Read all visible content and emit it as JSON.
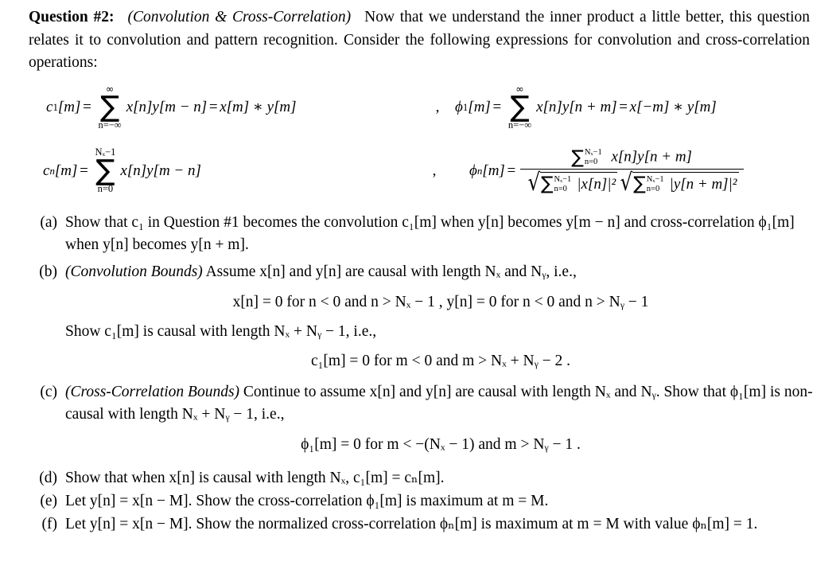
{
  "header": {
    "question_label": "Question #2:",
    "topic": "(Convolution & Cross-Correlation)",
    "paragraph": "Now that we understand the inner product a little better, this question relates it to convolution and pattern recognition. Consider the following expressions for convolution and cross-correlation operations:"
  },
  "equations": {
    "row1": {
      "c1": {
        "lhs_var": "c",
        "lhs_sub": "1",
        "lhs_arg": "[m]",
        "equals": "=",
        "sum_top": "∞",
        "sum_bottom": "n=−∞",
        "summand": "x[n]y[m − n]",
        "equals2": "=",
        "rhs": "x[m] ∗ y[m]"
      },
      "separator": ",",
      "phi1": {
        "lhs_var": "ϕ",
        "lhs_sub": "1",
        "lhs_arg": "[m]",
        "equals": "=",
        "sum_top": "∞",
        "sum_bottom": "n=−∞",
        "summand": "x[n]y[n + m]",
        "equals2": "=",
        "rhs": "x[−m] ∗ y[m]"
      }
    },
    "row2": {
      "cn": {
        "lhs_var": "c",
        "lhs_sub": "n",
        "lhs_arg": "[m]",
        "equals": "=",
        "sum_top": "Nₓ−1",
        "sum_bottom": "n=0",
        "summand": "x[n]y[m − n]"
      },
      "separator": ",",
      "phin": {
        "lhs_var": "ϕ",
        "lhs_sub": "n",
        "lhs_arg": "[m]",
        "equals": "=",
        "numerator_sum_top": "Nₓ−1",
        "numerator_sum_bottom": "n=0",
        "numerator_summand": "x[n]y[n + m]",
        "denom_left_sum_top": "Nₓ−1",
        "denom_left_sum_bottom": "n=0",
        "denom_left_summand": "|x[n]|²",
        "denom_right_sum_top": "Nₓ−1",
        "denom_right_sum_bottom": "n=0",
        "denom_right_summand": "|y[n + m]|²"
      }
    }
  },
  "parts": [
    {
      "marker": "(a)",
      "text_line1": "Show that c₁ in Question #1 becomes the convolution c₁[m] when y[n] becomes y[m − n] and",
      "text_line2": "cross-correlation ϕ₁[m] when y[n] becomes y[n + m]."
    },
    {
      "marker": "(b)",
      "title": "(Convolution Bounds)",
      "lead": "Assume x[n] and y[n] are causal with length Nₓ and Nᵧ, i.e.,",
      "display1": "x[n] = 0 for n < 0 and n > Nₓ − 1 , y[n] = 0 for n < 0 and n > Nᵧ − 1",
      "middle": "Show c₁[m] is causal with length Nₓ + Nᵧ − 1, i.e.,",
      "display2": "c₁[m] = 0 for m < 0 and m > Nₓ + Nᵧ − 2 ."
    },
    {
      "marker": "(c)",
      "title": "(Cross-Correlation Bounds)",
      "lead_line1": "Continue to assume x[n] and y[n] are causal with length Nₓ and",
      "lead_line2": "Nᵧ. Show that ϕ₁[m] is non-causal with length Nₓ + Nᵧ − 1, i.e.,",
      "display": "ϕ₁[m] = 0 for m < −(Nₓ − 1) and m > Nᵧ − 1 ."
    },
    {
      "marker": "(d)",
      "text": "Show that when x[n] is causal with length Nₓ, c₁[m] = cₙ[m]."
    },
    {
      "marker": "(e)",
      "text": "Let y[n] = x[n − M]. Show the cross-correlation ϕ₁[m] is maximum at m = M."
    },
    {
      "marker": "(f)",
      "text_line1": "Let y[n] = x[n − M]. Show the normalized cross-correlation ϕₙ[m] is maximum at m = M",
      "text_line2": "with value ϕₙ[m] = 1."
    }
  ],
  "symbols": {
    "sum": "∑",
    "infinity": "∞",
    "sqrt": "√",
    "phi": "ϕ",
    "asterisk": "∗",
    "minus": "−",
    "plus": "+",
    "equals": "=",
    "less_than": "<",
    "greater_than": ">",
    "comma": ",",
    "period": ".",
    "for": "for",
    "and": "and",
    "ie": "i.e.,",
    "zero": "0",
    "one": "1",
    "two": "2"
  }
}
